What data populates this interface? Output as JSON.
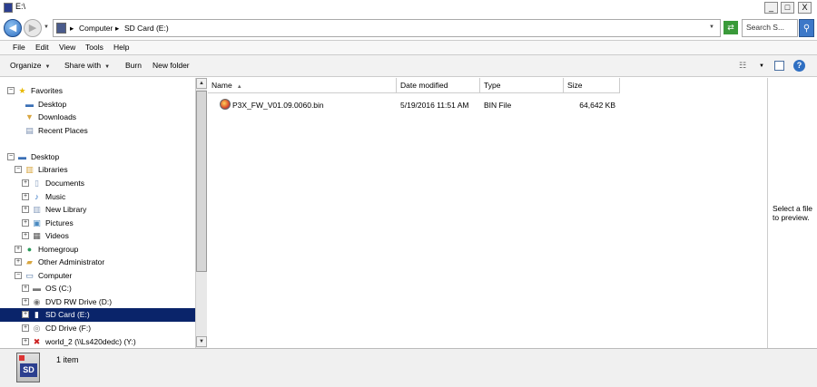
{
  "window": {
    "title": "E:\\",
    "min_glyph": "_",
    "max_glyph": "□",
    "close_glyph": "X"
  },
  "address": {
    "crumbs": [
      "Computer",
      "SD Card (E:)"
    ],
    "separator": "▸",
    "search_placeholder": "Search S..."
  },
  "menu": [
    "File",
    "Edit",
    "View",
    "Tools",
    "Help"
  ],
  "commands": {
    "organize": "Organize",
    "share_with": "Share with",
    "burn": "Burn",
    "new_folder": "New folder"
  },
  "tree": [
    {
      "label": "Favorites",
      "expander": "−",
      "icon": "star-icon",
      "glyph": "★",
      "color": "#e8b800"
    },
    {
      "label": "Desktop",
      "icon": "desktop-icon",
      "glyph": "▬",
      "color": "#3a6fb5"
    },
    {
      "label": "Downloads",
      "icon": "downloads-folder-icon",
      "glyph": "▼",
      "color": "#d8a640"
    },
    {
      "label": "Recent Places",
      "icon": "recent-places-icon",
      "glyph": "▤",
      "color": "#7a8fb0"
    },
    {
      "label": "Desktop",
      "expander": "−",
      "icon": "desktop-icon",
      "glyph": "▬",
      "color": "#3a6fb5"
    },
    {
      "label": "Libraries",
      "expander": "−",
      "icon": "libraries-icon",
      "glyph": "▥",
      "color": "#d8a640"
    },
    {
      "label": "Documents",
      "expander": "+",
      "icon": "documents-icon",
      "glyph": "▯",
      "color": "#8aa0c0"
    },
    {
      "label": "Music",
      "expander": "+",
      "icon": "music-icon",
      "glyph": "♪",
      "color": "#2a6fc2"
    },
    {
      "label": "New Library",
      "expander": "+",
      "icon": "library-icon",
      "glyph": "▥",
      "color": "#8aa0c0"
    },
    {
      "label": "Pictures",
      "expander": "+",
      "icon": "pictures-icon",
      "glyph": "▣",
      "color": "#4a8ac0"
    },
    {
      "label": "Videos",
      "expander": "+",
      "icon": "videos-icon",
      "glyph": "▦",
      "color": "#555"
    },
    {
      "label": "Homegroup",
      "expander": "+",
      "icon": "homegroup-icon",
      "glyph": "●",
      "color": "#2a9a5a"
    },
    {
      "label": "Other Administrator",
      "expander": "+",
      "icon": "user-folder-icon",
      "glyph": "▰",
      "color": "#d8a640"
    },
    {
      "label": "Computer",
      "expander": "−",
      "icon": "computer-icon",
      "glyph": "▭",
      "color": "#4a6fa0"
    },
    {
      "label": "OS (C:)",
      "expander": "+",
      "icon": "hard-drive-icon",
      "glyph": "▬",
      "color": "#777"
    },
    {
      "label": "DVD RW Drive (D:)",
      "expander": "+",
      "icon": "dvd-drive-icon",
      "glyph": "◉",
      "color": "#777"
    },
    {
      "label": "SD Card (E:)",
      "expander": "+",
      "icon": "sd-card-icon",
      "glyph": "▮",
      "color": "#ffffff",
      "selected": true
    },
    {
      "label": "CD Drive (F:)",
      "expander": "+",
      "icon": "cd-drive-icon",
      "glyph": "◎",
      "color": "#777"
    },
    {
      "label": "world_2 (\\\\Ls420dedc) (Y:)",
      "expander": "+",
      "icon": "network-drive-icon",
      "glyph": "✖",
      "color": "#cc2222"
    }
  ],
  "columns": {
    "name": "Name",
    "date_modified": "Date modified",
    "type": "Type",
    "size": "Size"
  },
  "files": [
    {
      "name": "P3X_FW_V01.09.0060.bin",
      "date_modified": "5/19/2016 11:51 AM",
      "type": "BIN File",
      "size": "64,642 KB"
    }
  ],
  "preview": {
    "message": "Select a file to preview."
  },
  "status": {
    "count": "1 item",
    "sd_icon_text": "SD"
  }
}
